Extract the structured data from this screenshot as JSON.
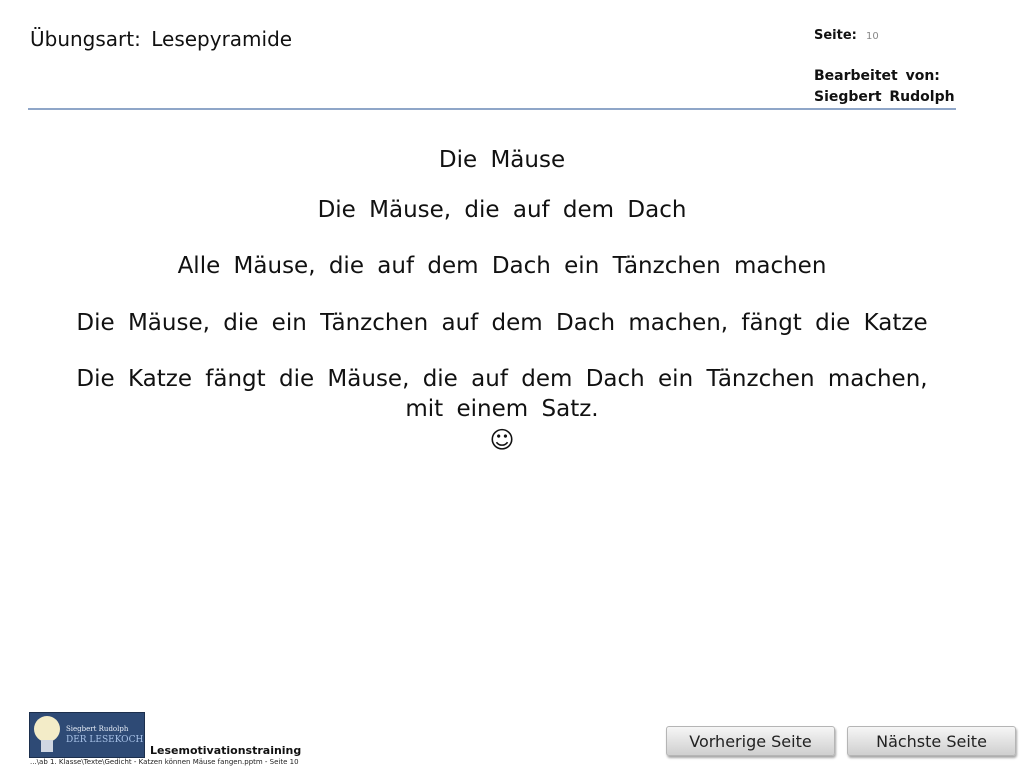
{
  "header": {
    "exercise_type": "Übungsart:  Lesepyramide",
    "page_label": "Seite:",
    "page_number": "10",
    "edited_by_label": "Bearbeitet von:",
    "author": "Siegbert Rudolph"
  },
  "pyramid": {
    "line_1": "Die Mäuse",
    "line_2": "Die Mäuse, die auf dem Dach",
    "line_3": "Alle Mäuse, die auf dem Dach ein Tänzchen machen",
    "line_4": "Die Mäuse, die ein Tänzchen auf dem Dach machen, fängt die Katze",
    "line_5a": "Die Katze fängt die Mäuse, die auf dem Dach ein Tänzchen machen,",
    "line_5b": "mit einem Satz.",
    "smiley": "☺"
  },
  "logo": {
    "name_small": "Siegbert Rudolph",
    "name_big": "DER LESEKOCH"
  },
  "footer": {
    "label": "Lesemotivationstraining",
    "path": "...\\ab 1. Klasse\\Texte\\Gedicht - Katzen können Mäuse fangen.pptm - Seite 10"
  },
  "navigation": {
    "prev_label": "Vorherige Seite",
    "next_label": "Nächste Seite"
  }
}
